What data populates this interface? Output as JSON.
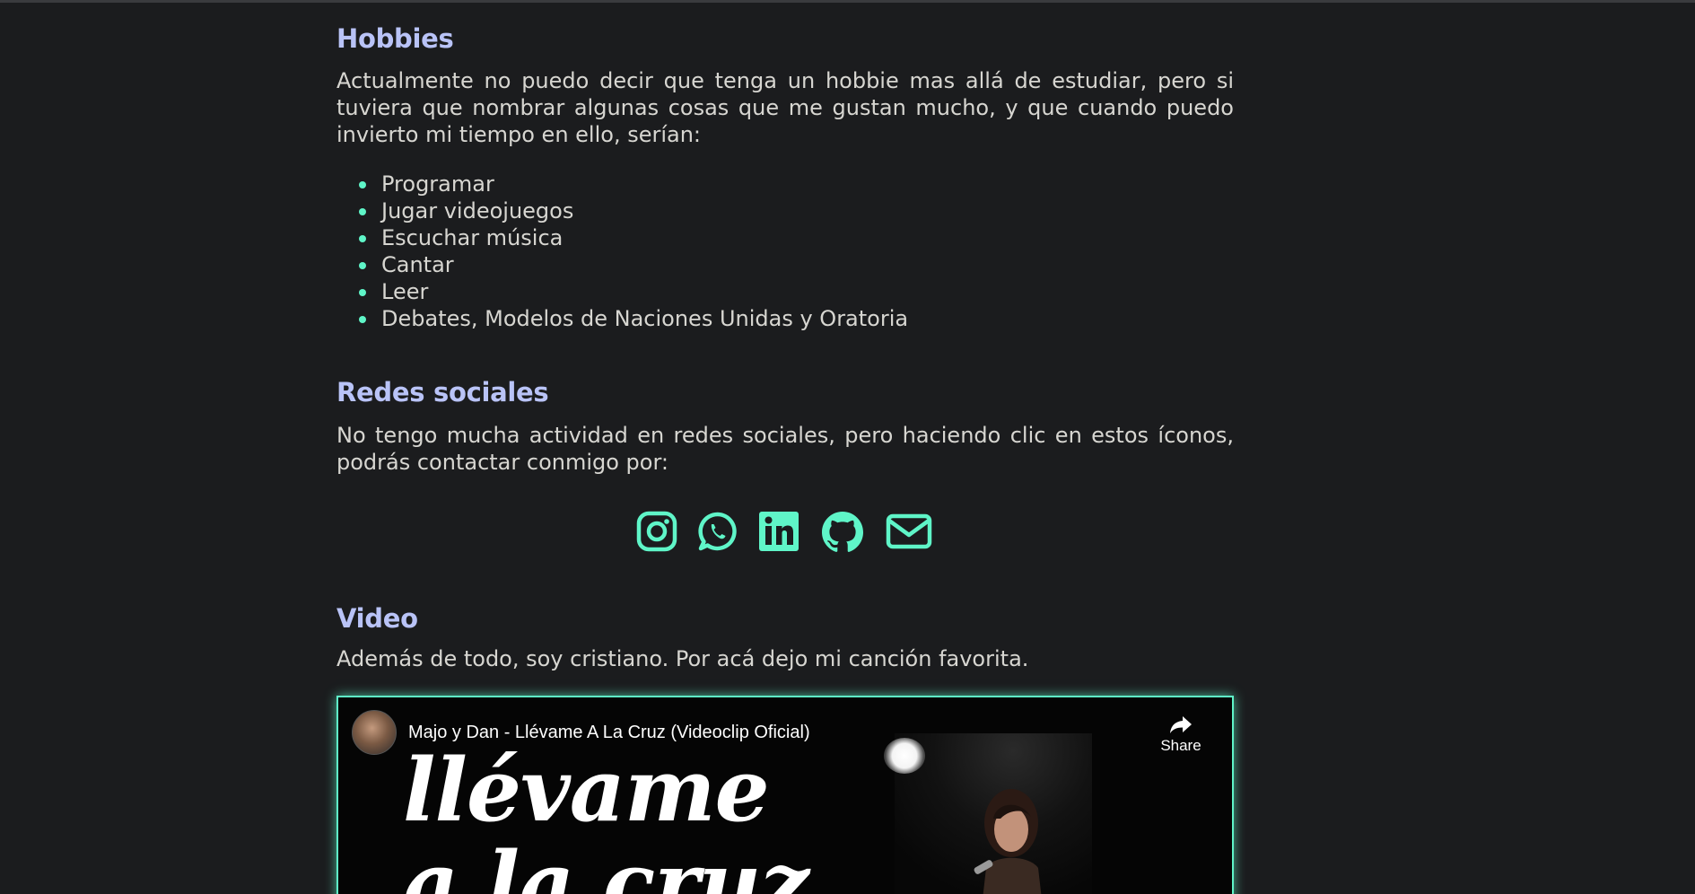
{
  "hobbies": {
    "title": "Hobbies",
    "text": "Actualmente no puedo decir que tenga un hobbie mas allá de estudiar, pero si tuviera que nombrar algunas cosas que me gustan mucho, y que cuando puedo invierto mi tiempo en ello, serían:",
    "items": [
      "Programar",
      "Jugar videojuegos",
      "Escuchar música",
      "Cantar",
      "Leer",
      "Debates, Modelos de Naciones Unidas y Oratoria"
    ]
  },
  "social": {
    "title": "Redes sociales",
    "text": "No tengo mucha actividad en redes sociales, pero haciendo clic en estos íconos, podrás contactar conmigo por:",
    "icons": [
      "instagram-icon",
      "whatsapp-icon",
      "linkedin-icon",
      "github-icon",
      "email-icon"
    ]
  },
  "video": {
    "title": "Video",
    "text": "Además de todo, soy cristiano. Por acá dejo mi canción favorita.",
    "embed_title": "Majo y Dan - Llévame A La Cruz (Videoclip Oficial)",
    "share_label": "Share",
    "cover_line1": "llévame",
    "cover_line2": "a la cruz"
  },
  "colors": {
    "background": "#1b1c1e",
    "heading": "#b9c3f7",
    "text": "#d7d6d1",
    "accent": "#5ff5c8"
  }
}
